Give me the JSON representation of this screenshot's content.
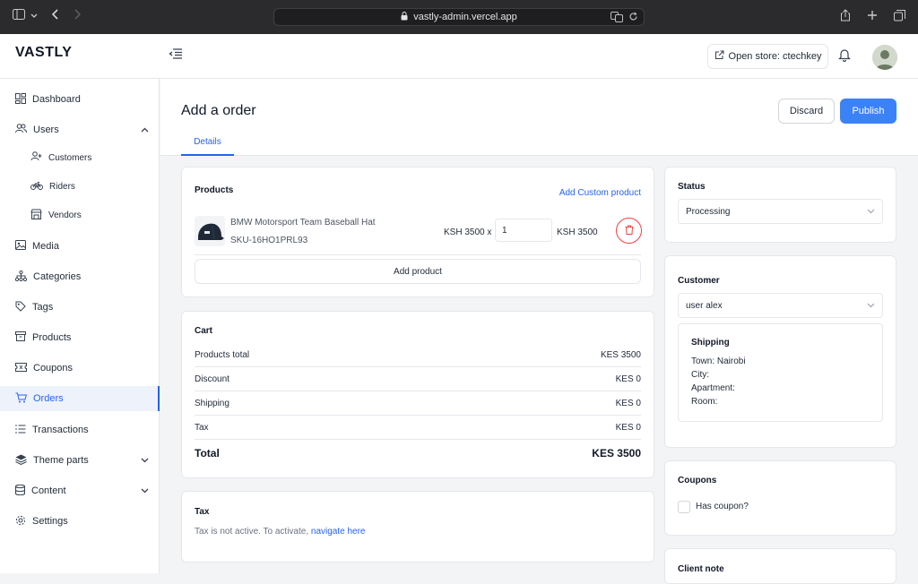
{
  "browser": {
    "url": "vastly-admin.vercel.app"
  },
  "app": {
    "logo": "VASTLY",
    "open_store_label": "Open store: ctechkey"
  },
  "sidebar": {
    "items": [
      {
        "label": "Dashboard",
        "icon": "dashboard-icon"
      },
      {
        "label": "Users",
        "icon": "users-icon",
        "expanded": true
      },
      {
        "label": "Customers",
        "icon": "user-plus-icon",
        "sub": true
      },
      {
        "label": "Riders",
        "icon": "bike-icon",
        "sub": true
      },
      {
        "label": "Vendors",
        "icon": "store-icon",
        "sub": true
      },
      {
        "label": "Media",
        "icon": "image-icon"
      },
      {
        "label": "Categories",
        "icon": "sitemap-icon"
      },
      {
        "label": "Tags",
        "icon": "tag-icon"
      },
      {
        "label": "Products",
        "icon": "box-icon"
      },
      {
        "label": "Coupons",
        "icon": "ticket-icon"
      },
      {
        "label": "Orders",
        "icon": "cart-icon",
        "active": true
      },
      {
        "label": "Transactions",
        "icon": "list-icon"
      },
      {
        "label": "Theme parts",
        "icon": "layers-icon",
        "collapsible": true
      },
      {
        "label": "Content",
        "icon": "database-icon",
        "collapsible": true
      },
      {
        "label": "Settings",
        "icon": "gear-icon"
      }
    ]
  },
  "page": {
    "title": "Add a order",
    "tabs": [
      "Details"
    ],
    "discard_label": "Discard",
    "publish_label": "Publish"
  },
  "products": {
    "title": "Products",
    "add_custom_label": "Add Custom product",
    "items": [
      {
        "name": "BMW Motorsport Team Baseball Hat",
        "sku": "SKU-16HO1PRL93",
        "unit_price": "KSH 3500 x",
        "quantity": "1",
        "line_total": "KSH 3500"
      }
    ],
    "add_product_label": "Add product"
  },
  "cart": {
    "title": "Cart",
    "rows": [
      {
        "label": "Products total",
        "value": "KES 3500"
      },
      {
        "label": "Discount",
        "value": "KES 0"
      },
      {
        "label": "Shipping",
        "value": "KES 0"
      },
      {
        "label": "Tax",
        "value": "KES 0"
      }
    ],
    "total_label": "Total",
    "total_value": "KES 3500"
  },
  "tax": {
    "title": "Tax",
    "message": "Tax is not active. To activate,",
    "link_label": "navigate here"
  },
  "status": {
    "title": "Status",
    "value": "Processing"
  },
  "customer": {
    "title": "Customer",
    "value": "user alex",
    "shipping_title": "Shipping",
    "town": "Town: Nairobi",
    "city": "City:",
    "apartment": "Apartment:",
    "room": "Room:"
  },
  "coupons": {
    "title": "Coupons",
    "checkbox_label": "Has coupon?"
  },
  "client_note": {
    "title": "Client note"
  },
  "colors": {
    "accent": "#3b82f6",
    "danger": "#ef4444"
  }
}
